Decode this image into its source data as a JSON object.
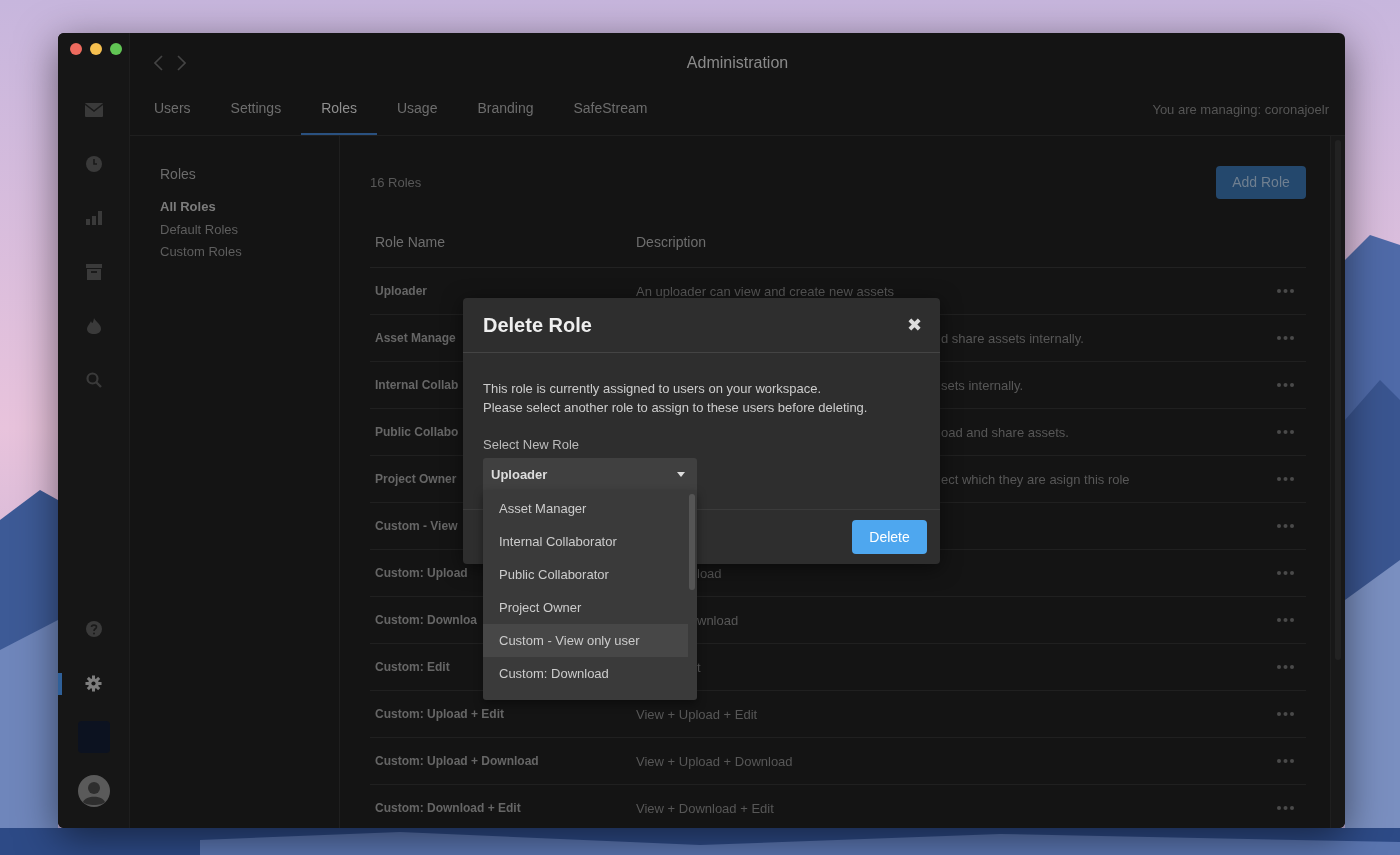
{
  "window": {
    "title": "Administration"
  },
  "rail": [
    {
      "kind": "mail",
      "selected": false
    },
    {
      "kind": "clock",
      "selected": false
    },
    {
      "kind": "chart",
      "selected": false
    },
    {
      "kind": "archive",
      "selected": false
    },
    {
      "kind": "flame",
      "selected": false
    },
    {
      "kind": "search",
      "selected": false
    }
  ],
  "rail_bottom": [
    {
      "kind": "help",
      "selected": false
    },
    {
      "kind": "settings",
      "selected": true
    },
    {
      "kind": "workspace",
      "selected": false
    },
    {
      "kind": "avatar",
      "selected": false
    }
  ],
  "tabs": [
    {
      "label": "Users",
      "selected": false
    },
    {
      "label": "Settings",
      "selected": false
    },
    {
      "label": "Roles",
      "selected": true
    },
    {
      "label": "Usage",
      "selected": false
    },
    {
      "label": "Branding",
      "selected": false
    },
    {
      "label": "SafeStream",
      "selected": false
    }
  ],
  "managing": "You are managing: coronajoelr",
  "sidebar": {
    "heading": "Roles",
    "items": [
      {
        "label": "All Roles",
        "selected": true
      },
      {
        "label": "Default Roles",
        "selected": false
      },
      {
        "label": "Custom Roles",
        "selected": false
      }
    ]
  },
  "content": {
    "count": "16 Roles",
    "add_button": "Add Role",
    "columns": [
      "Role Name",
      "Description"
    ],
    "rows": [
      {
        "name": "Uploader",
        "description": "An uploader can view and create new assets"
      },
      {
        "name": "Asset Manage",
        "description": "d share assets internally.",
        "kind": "trailing"
      },
      {
        "name": "Internal Collab",
        "description": "sets internally.",
        "kind": "trailing"
      },
      {
        "name": "Public Collabo",
        "description": "oad and share assets.",
        "kind": "trailing"
      },
      {
        "name": "Project Owner",
        "description": "ect which they are asign this role",
        "kind": "trailing"
      },
      {
        "name": "Custom - View"
      },
      {
        "name": "Custom: Upload",
        "description": "load",
        "kind": "partial"
      },
      {
        "name": "Custom: Downloa",
        "description": "wnload",
        "kind": "partial"
      },
      {
        "name": "Custom: Edit",
        "description": "t",
        "kind": "partial"
      },
      {
        "name": "Custom: Upload + Edit",
        "description": "View + Upload + Edit"
      },
      {
        "name": "Custom: Upload + Download",
        "description": "View + Upload + Download"
      },
      {
        "name": "Custom: Download + Edit",
        "description": "View + Download + Edit"
      }
    ]
  },
  "dialog": {
    "title": "Delete Role",
    "close": "✖",
    "message_lines": [
      "This role is currently assigned to users on your workspace.",
      "Please select another role to assign to these users before deleting."
    ],
    "field_label": "Select New Role",
    "select_value": "Uploader",
    "options": [
      {
        "label": "Asset Manager",
        "selected": false
      },
      {
        "label": "Internal Collaborator",
        "selected": false
      },
      {
        "label": "Public Collaborator",
        "selected": false
      },
      {
        "label": "Project Owner",
        "selected": false
      },
      {
        "label": "Custom - View only user",
        "selected": true
      },
      {
        "label": "Custom: Download",
        "selected": false
      }
    ],
    "button": "Delete"
  }
}
